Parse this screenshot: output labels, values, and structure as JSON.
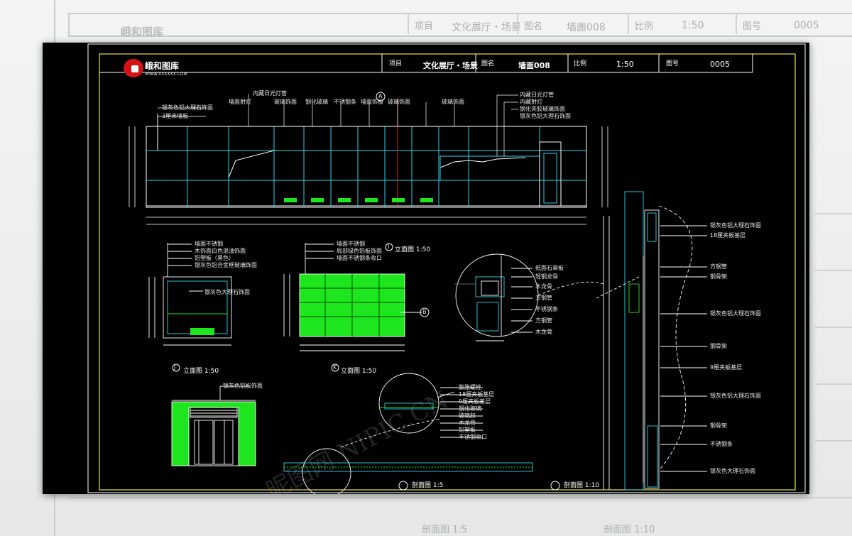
{
  "title_block": {
    "logo_name": "峨和图库",
    "logo_sub": "WWW.XXXXXX.COM",
    "project_label": "项目",
    "project_value": "文化展厅・场景",
    "drawing_label": "图名",
    "drawing_value": "墙面008",
    "scale_label": "比例",
    "scale_value": "1:50",
    "number_label": "图号",
    "number_value": "0005"
  },
  "background_title_block": {
    "logo_name": "峨和图库",
    "project_label": "项目",
    "project_value": "文化展厅・场景",
    "drawing_label": "图名",
    "drawing_value": "墙面008",
    "scale_label": "比例",
    "scale_value": "1:50",
    "number_label": "图号",
    "number_value": "0005"
  },
  "callouts": {
    "marker_a": "A",
    "marker_b": "B",
    "marker_i": "I",
    "marker_j": "J",
    "marker_k": "K"
  },
  "elevation_labels": {
    "top_notes": [
      "内藏日光灯管",
      "墙面射灯",
      "玻璃饰面",
      "钢化玻璃",
      "不锈钢条",
      "墙面饰板",
      "玻璃饰面",
      "玻璃饰面"
    ],
    "left_notes": [
      "银灰色铝大理石饰面",
      "3厘米墙板"
    ],
    "right_notes": [
      "内藏日光灯管",
      "内藏射灯",
      "钢化夹胶玻璃饰面",
      "银灰色铝大理石饰面"
    ]
  },
  "view_titles": {
    "i": "立面图 1:50",
    "j": "立面图 1:50",
    "k": "立面图 1:50",
    "b": "剖面图 1:5",
    "a": "剖面图 1:10"
  },
  "section_notes": {
    "j_notes": [
      "墙面不锈钢",
      "木饰面白色混油饰面",
      "铝塑板（黑色）",
      "银灰色铝合金框玻璃饰面",
      "银灰色大理石饰面"
    ],
    "k_notes": [
      "墙面不锈钢",
      "局部绿色铝板饰面",
      "墙面不锈钢条收口"
    ],
    "i_notes": [
      "银灰色铝板饰面"
    ],
    "detail_notes": [
      "纸面石膏板",
      "轻钢龙骨",
      "木龙骨",
      "方钢管",
      "不锈钢条",
      "方钢管",
      "木龙骨"
    ],
    "b_notes": [
      "膨胀螺栓",
      "18厘夹板基层",
      "9厘夹板基层",
      "钢化玻璃",
      "玻璃胶",
      "木龙骨",
      "铝塑板",
      "不锈钢收口"
    ],
    "right_notes": [
      "银灰色铝大理石饰面",
      "18厘夹板基层",
      "方钢管",
      "钢骨架",
      "银灰色铝大理石饰面",
      "钢骨架",
      "9厘夹板基层",
      "银灰色铝大理石饰面",
      "钢骨架",
      "不锈钢条",
      "银灰色大理石饰面"
    ]
  },
  "watermark": "昵图网 NIPIC.CN",
  "colors": {
    "canvas": "#000000",
    "frame_yellow": "#e8e23a",
    "line_cyan": "#29d3e8",
    "line_green": "#1ee61e",
    "line_white": "#ffffff",
    "accent_red": "#d41414"
  }
}
